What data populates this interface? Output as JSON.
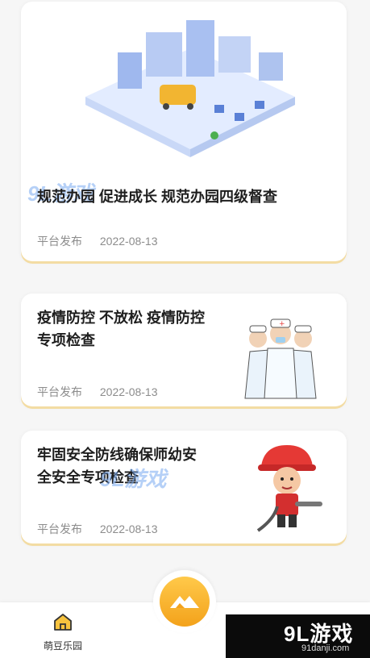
{
  "cards": [
    {
      "title": "规范办园 促进成长 规范办园四级督查",
      "publisher": "平台发布",
      "date": "2022-08-13"
    },
    {
      "title_line1": "疫情防控 不放松 疫情防控",
      "title_line2": "专项检查",
      "publisher": "平台发布",
      "date": "2022-08-13"
    },
    {
      "title_line1": "牢固安全防线确保师幼安",
      "title_line2": "全安全专项检查",
      "publisher": "平台发布",
      "date": "2022-08-13"
    }
  ],
  "watermark": {
    "text": "9L游戏",
    "sub": "91danji.com"
  },
  "tabbar": {
    "home_label": "萌豆乐园"
  },
  "brand_corner": {
    "main": "9L游戏",
    "sub": "91danji.com"
  },
  "colors": {
    "accent": "#f3a21b",
    "card_shadow": "#f3dca3"
  }
}
